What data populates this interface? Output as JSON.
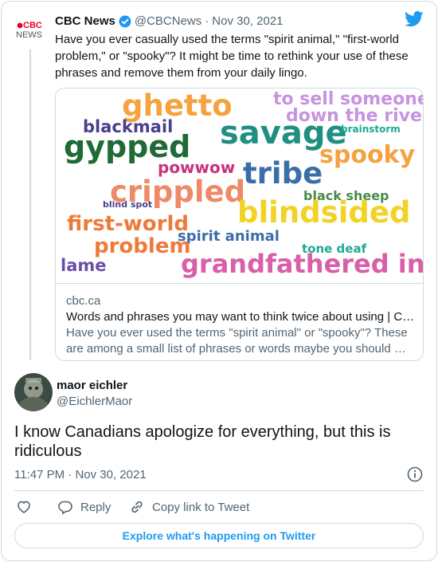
{
  "quoted": {
    "source_logo": "CBC NEWS",
    "name": "CBC News",
    "handle": "@CBCNews",
    "separator": "·",
    "date": "Nov 30, 2021",
    "text": "Have you ever casually used the terms \"spirit animal,\" \"first-world problem,\" or \"spooky\"? It might be time to rethink your use of these phrases and remove them from your daily lingo.",
    "link_card": {
      "domain": "cbc.ca",
      "title": "Words and phrases you may want to think twice about using | C…",
      "description": "Have you ever used the terms \"spirit animal\" or \"spooky\"? These are among a small list of phrases or words maybe you should …"
    }
  },
  "wordcloud": {
    "words": [
      {
        "text": "ghetto",
        "color": "#f4a340"
      },
      {
        "text": "to sell someone",
        "color": "#c893e0"
      },
      {
        "text": "down the river",
        "color": "#c893e0"
      },
      {
        "text": "blackmail",
        "color": "#4a3f8c"
      },
      {
        "text": "savage",
        "color": "#1f8f82"
      },
      {
        "text": "brainstorm",
        "color": "#1fa893"
      },
      {
        "text": "gypped",
        "color": "#1e6b35"
      },
      {
        "text": "spooky",
        "color": "#f4a340"
      },
      {
        "text": "powwow",
        "color": "#c8337a"
      },
      {
        "text": "tribe",
        "color": "#3b6ea8"
      },
      {
        "text": "crippled",
        "color": "#ee8a67"
      },
      {
        "text": "black sheep",
        "color": "#4a8a4a"
      },
      {
        "text": "blind spot",
        "color": "#4a3f8c"
      },
      {
        "text": "blindsided",
        "color": "#f2d224"
      },
      {
        "text": "first-world",
        "color": "#ee7a3a"
      },
      {
        "text": "spirit animal",
        "color": "#3b6ea8"
      },
      {
        "text": "problem",
        "color": "#ee7a3a"
      },
      {
        "text": "tone deaf",
        "color": "#1fa893"
      },
      {
        "text": "lame",
        "color": "#6a4fa8"
      },
      {
        "text": "grandfathered in",
        "color": "#d860a8"
      }
    ]
  },
  "reply": {
    "name": "maor eichler",
    "handle": "@EichlerMaor",
    "text": "I know Canadians apologize for everything, but this is ridiculous",
    "time": "11:47 PM",
    "separator": "·",
    "date": "Nov 30, 2021"
  },
  "actions": {
    "reply_label": "Reply",
    "copy_label": "Copy link to Tweet"
  },
  "explore_label": "Explore what's happening on Twitter",
  "colors": {
    "accent": "#1d9bf0",
    "text": "#0f1419",
    "muted": "#536471",
    "border": "#cfd9de",
    "cbc_red": "#e4002b"
  },
  "icons": [
    "twitter-bird-icon",
    "verified-badge-icon",
    "info-icon",
    "heart-icon",
    "reply-icon",
    "copy-link-icon"
  ]
}
